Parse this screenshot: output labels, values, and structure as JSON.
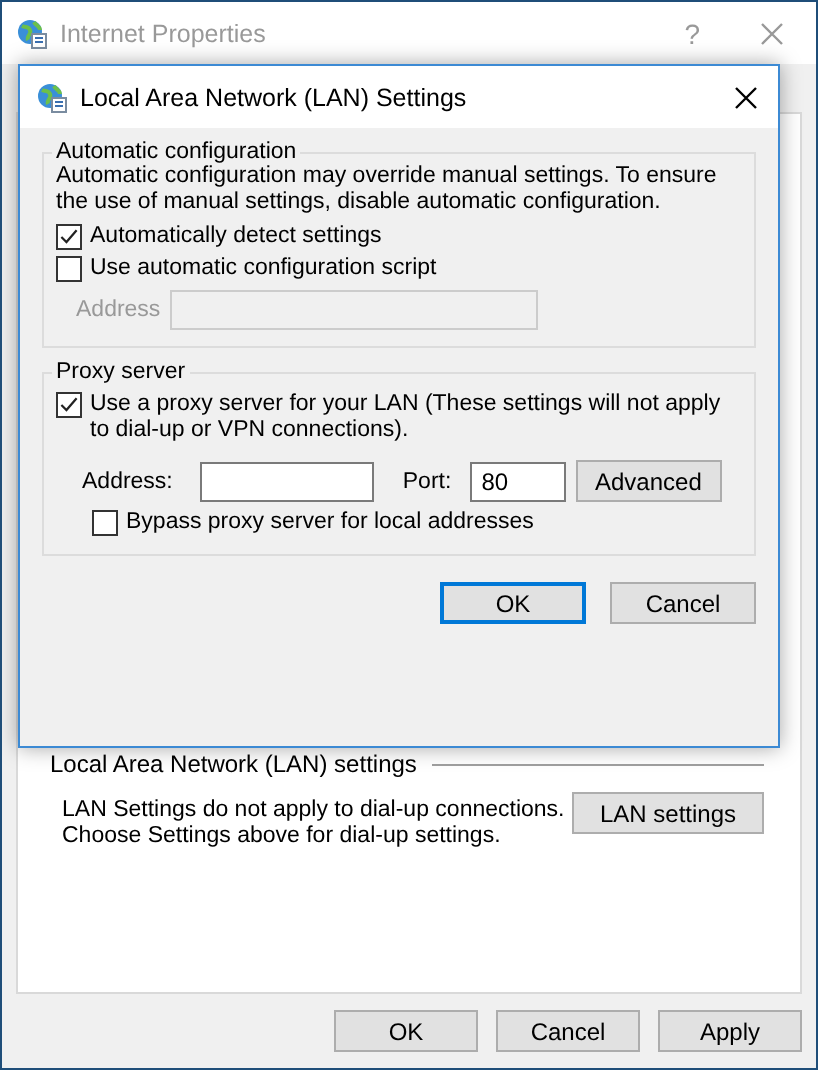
{
  "window": {
    "title": "Internet Properties",
    "help": "?"
  },
  "lan_section": {
    "title": "Local Area Network (LAN) settings",
    "text": "LAN Settings do not apply to dial-up connections.\nChoose Settings above for dial-up settings.",
    "button": "LAN settings"
  },
  "buttons": [
    {
      "label": "OK",
      "disabled": false
    },
    {
      "label": "Cancel",
      "disabled": false
    },
    {
      "label": "Apply",
      "disabled": false
    }
  ],
  "dialog": {
    "title": "Local Area Network (LAN) Settings",
    "auto_config": {
      "title": "Automatic configuration",
      "description": "Automatic configuration may override manual settings.  To ensure the use of manual settings, disable automatic configuration.",
      "options": [
        {
          "label": "Automatically detect settings",
          "checked": true
        },
        {
          "label": "Use automatic configuration script",
          "checked": false
        }
      ],
      "script_address": {
        "label": "Address",
        "disabled": true
      }
    },
    "proxy": {
      "title": "Proxy server",
      "use_proxy": {
        "label": "Use a proxy server for your LAN (These settings will not apply to dial-up or VPN connections).",
        "checked": true
      },
      "address": {
        "label": "Address:"
      },
      "port": {
        "label": "Port:",
        "value": "80"
      },
      "advanced_button": "Advanced",
      "bypass": {
        "label": "Bypass proxy server for local addresses",
        "checked": false
      }
    },
    "buttons": [
      {
        "label": "OK",
        "default": true
      },
      {
        "label": "Cancel",
        "default": false
      }
    ]
  }
}
